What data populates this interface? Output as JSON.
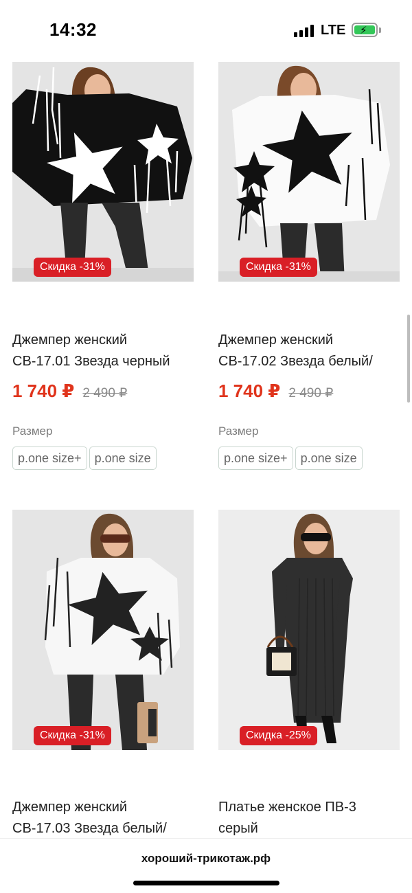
{
  "status_bar": {
    "time": "14:32",
    "network": "LTE",
    "battery_icon": "battery-charging-icon",
    "battery_color": "#34c759"
  },
  "colors": {
    "price": "#e0341c",
    "badge": "#d91f26",
    "old_price": "#8a8a8a"
  },
  "products": [
    {
      "badge": "Скидка -31%",
      "title_line1": "Джемпер женский",
      "title_line2": "СВ-17.01 Звезда черный",
      "price": "1 740 ₽",
      "old_price": "2 490 ₽",
      "size_label": "Размер",
      "sizes": [
        "р.one size+",
        "р.one size"
      ]
    },
    {
      "badge": "Скидка -31%",
      "title_line1": "Джемпер женский",
      "title_line2": "СВ-17.02 Звезда белый/",
      "price": "1 740 ₽",
      "old_price": "2 490 ₽",
      "size_label": "Размер",
      "sizes": [
        "р.one size+",
        "р.one size"
      ]
    },
    {
      "badge": "Скидка -31%",
      "title_line1": "Джемпер женский",
      "title_line2": "СВ-17.03 Звезда белый/"
    },
    {
      "badge": "Скидка -25%",
      "title_line1": "Платье женское ПВ-3",
      "title_line2": "серый"
    }
  ],
  "browser": {
    "url": "хороший-трикотаж.рф"
  }
}
